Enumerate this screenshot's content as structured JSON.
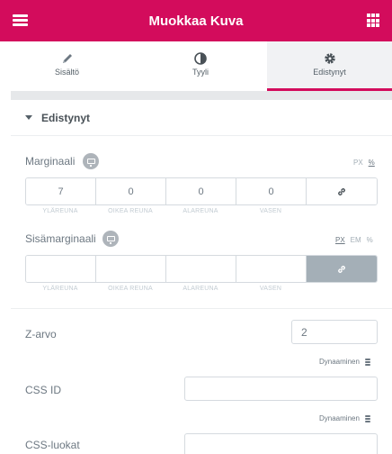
{
  "header": {
    "title": "Muokkaa Kuva"
  },
  "tabs": [
    {
      "label": "Sisältö",
      "icon": "pencil-icon"
    },
    {
      "label": "Tyyli",
      "icon": "contrast-icon"
    },
    {
      "label": "Edistynyt",
      "icon": "gear-icon",
      "active": true
    }
  ],
  "section": {
    "title": "Edistynyt"
  },
  "margin": {
    "label": "Marginaali",
    "units": [
      "PX",
      "%"
    ],
    "active_unit": "PX",
    "values": [
      "7",
      "0",
      "0",
      "0"
    ],
    "sides": [
      "YLÄREUNA",
      "OIKEA REUNA",
      "ALAREUNA",
      "VASEN"
    ],
    "linked": false
  },
  "padding": {
    "label": "Sisämarginaali",
    "units": [
      "PX",
      "EM",
      "%"
    ],
    "active_unit": "PX",
    "values": [
      "",
      "",
      "",
      ""
    ],
    "sides": [
      "YLÄREUNA",
      "OIKEA REUNA",
      "ALAREUNA",
      "VASEN"
    ],
    "linked": true
  },
  "z_index": {
    "label": "Z-arvo",
    "value": "2"
  },
  "css_id": {
    "label": "CSS ID",
    "dynamic_label": "Dynaaminen",
    "value": ""
  },
  "css_classes": {
    "label": "CSS-luokat",
    "dynamic_label": "Dynaaminen",
    "value": ""
  },
  "colors": {
    "brand": "#d30c5c",
    "text": "#6d7882",
    "border": "#d5dadf"
  }
}
